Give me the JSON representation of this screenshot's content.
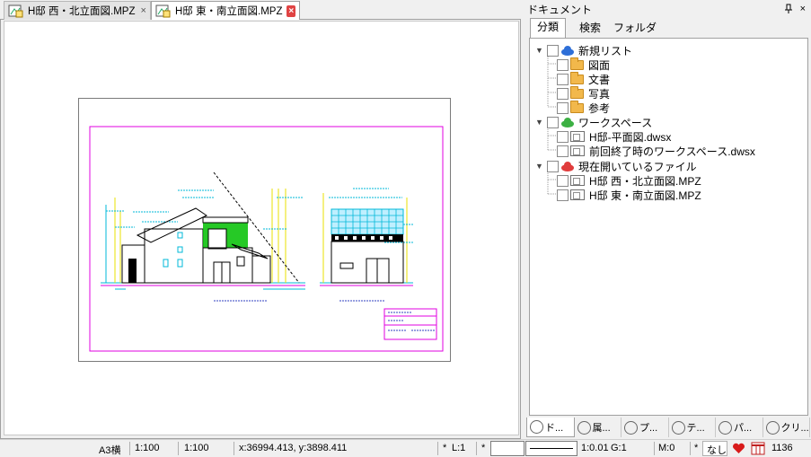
{
  "document_tabs": [
    {
      "label": "H邸 西・北立面図.MPZ",
      "close": "×"
    },
    {
      "label": "H邸 東・南立面図.MPZ",
      "close": "×"
    }
  ],
  "panel": {
    "title": "ドキュメント",
    "pin_icon": "pin-icon",
    "close_label": "×",
    "tabs": [
      "分類",
      "検索",
      "フォルダ"
    ],
    "tree": {
      "new_list": {
        "label": "新規リスト",
        "children": [
          "図面",
          "文書",
          "写真",
          "参考"
        ]
      },
      "workspace": {
        "label": "ワークスペース",
        "children": [
          "H邸-平面図.dwsx",
          "前回終了時のワークスペース.dwsx"
        ]
      },
      "open_files": {
        "label": "現在開いているファイル",
        "children": [
          "H邸 西・北立面図.MPZ",
          "H邸 東・南立面図.MPZ"
        ]
      }
    },
    "bottom_tabs": [
      "ド...",
      "属...",
      "プ...",
      "テ...",
      "パ...",
      "クリ..."
    ]
  },
  "status": {
    "paper": "A3横",
    "scale1": "1:100",
    "scale2": "1:100",
    "coords": "x:36994.413, y:3898.411",
    "star1": "*",
    "layer": "L:1",
    "star2": "*",
    "line_scale": "1:0.01",
    "group": "G:1",
    "mode": "M:0",
    "star3": "*",
    "none_label": "なし",
    "count": "1136"
  },
  "colors": {
    "magenta": "#e000e0",
    "cyan": "#00b8d8",
    "yellow": "#e8e000",
    "green": "#00c000"
  }
}
